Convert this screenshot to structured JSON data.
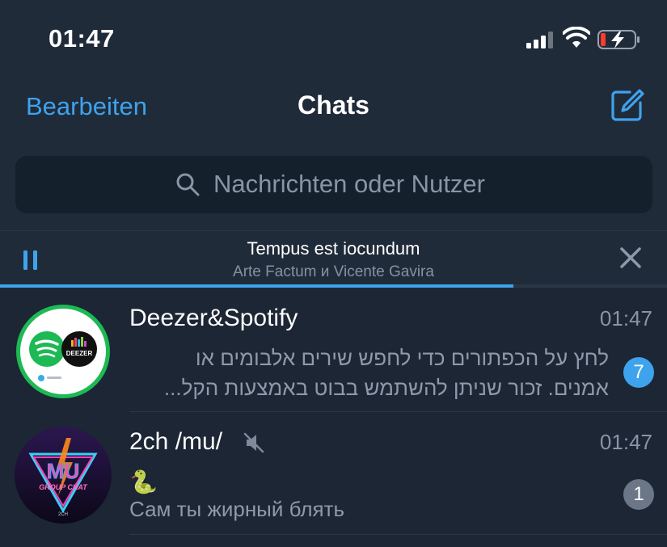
{
  "status_bar": {
    "time": "01:47"
  },
  "nav": {
    "edit_label": "Bearbeiten",
    "title": "Chats"
  },
  "search": {
    "placeholder": "Nachrichten oder Nutzer"
  },
  "player": {
    "title": "Tempus est iocundum",
    "artist": "Arte Factum и Vicente Gavira",
    "progress": 0.77
  },
  "chats": [
    {
      "name": "Deezer&Spotify",
      "time": "01:47",
      "preview_line1": "לחץ על הכפתורים כדי לחפש שירים אלבומים או",
      "preview_line2": "אמנים. זכור שניתן להשתמש בבוט באמצעות הקל...",
      "unread": "7",
      "badge_color": "#3ea3ec",
      "avatar_text": "DEEZER",
      "muted": false
    },
    {
      "name": "2ch /mu/",
      "time": "01:47",
      "preview_line1": "🐍",
      "preview_line2": "Сам ты жирный блять",
      "unread": "1",
      "badge_color": "#6b7787",
      "avatar_text": "MU",
      "avatar_subtext": "GROUP CHAT",
      "avatar_footer": "2CH",
      "muted": true
    }
  ],
  "colors": {
    "accent": "#3ea3ec",
    "background": "#1c2634",
    "header": "#202b3a"
  }
}
